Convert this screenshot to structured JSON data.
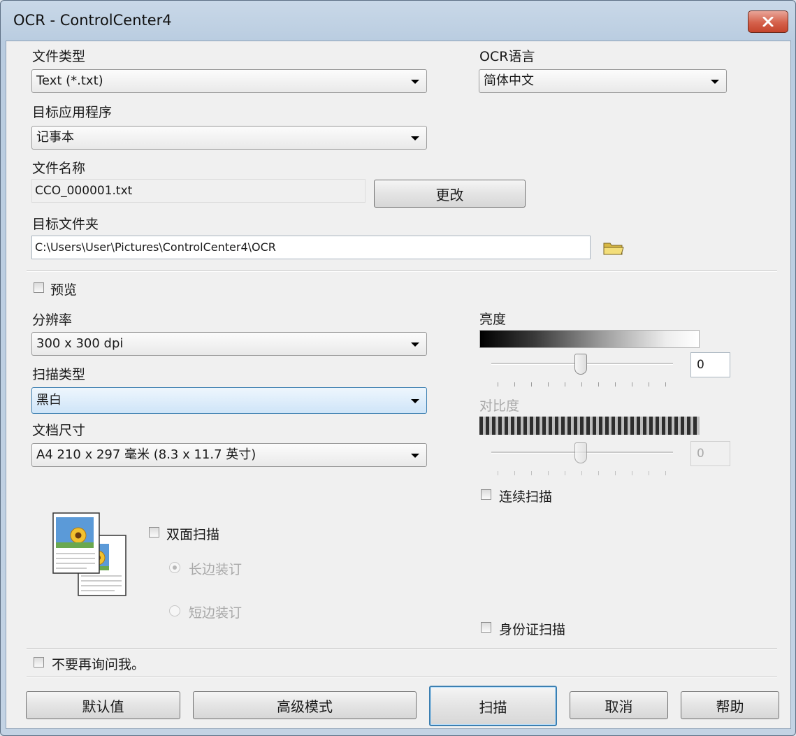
{
  "window": {
    "title": "OCR - ControlCenter4"
  },
  "file_type": {
    "label": "文件类型",
    "value": "Text (*.txt)"
  },
  "ocr_language": {
    "label": "OCR语言",
    "value": "简体中文"
  },
  "target_app": {
    "label": "目标应用程序",
    "value": "记事本"
  },
  "file_name": {
    "label": "文件名称",
    "value": "CCO_000001.txt",
    "change_label": "更改"
  },
  "target_folder": {
    "label": "目标文件夹",
    "value": "C:\\Users\\User\\Pictures\\ControlCenter4\\OCR"
  },
  "preview": {
    "label": "预览",
    "checked": false
  },
  "resolution": {
    "label": "分辨率",
    "value": "300 x 300 dpi"
  },
  "scan_type": {
    "label": "扫描类型",
    "value": "黑白"
  },
  "doc_size": {
    "label": "文档尺寸",
    "value": "A4 210 x 297 毫米 (8.3 x 11.7 英寸)"
  },
  "brightness": {
    "label": "亮度",
    "value": "0"
  },
  "contrast": {
    "label": "对比度",
    "value": "0",
    "disabled": true
  },
  "continuous_scan": {
    "label": "连续扫描",
    "checked": false
  },
  "duplex": {
    "label": "双面扫描",
    "checked": false,
    "long_edge": "长边装订",
    "short_edge": "短边装订",
    "selected": "long_edge"
  },
  "id_card_scan": {
    "label": "身份证扫描",
    "checked": false
  },
  "dont_ask": {
    "label": "不要再询问我。",
    "checked": false
  },
  "buttons": {
    "default": "默认值",
    "advanced": "高级模式",
    "scan": "扫描",
    "cancel": "取消",
    "help": "帮助"
  }
}
